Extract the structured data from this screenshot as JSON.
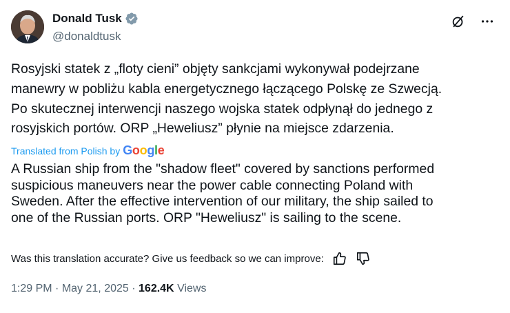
{
  "author": {
    "display_name": "Donald Tusk",
    "handle": "@donaldtusk",
    "verified_color": "#829aab"
  },
  "post": {
    "original_text": "Rosyjski statek z „floty cieni” objęty sankcjami wykonywał podejrzane\nmanewry w pobliżu kabla energetycznego łączącego Polskę ze Szwecją.\nPo skutecznej interwencji naszego wojska statek odpłynął do jednego z\nrosyjskich portów. ORP „Heweliusz” płynie na miejsce zdarzenia.",
    "translated_label": "Translated from Polish by",
    "translation_provider": "Google",
    "translated_text": "A Russian ship from the \"shadow fleet\" covered by sanctions performed\nsuspicious maneuvers near the power cable connecting Poland with\nSweden. After the effective intervention of our military, the ship sailed to\none of the Russian ports. ORP \"Heweliusz\" is sailing to the scene.",
    "feedback_prompt": "Was this translation accurate? Give us feedback so we can improve:"
  },
  "meta": {
    "time": "1:29 PM",
    "separator": "·",
    "date": "May 21, 2025",
    "views_count": "162.4K",
    "views_label": "Views"
  },
  "icons": {
    "verified": "verified-badge-icon",
    "grok": "grok-icon",
    "more": "more-options-icon",
    "thumbs_up": "thumbs-up-icon",
    "thumbs_down": "thumbs-down-icon"
  },
  "colors": {
    "link_blue": "#1d9bf0",
    "secondary_text": "#536471",
    "primary_text": "#0f1419",
    "google_blue": "#4285F4",
    "google_red": "#EA4335",
    "google_yellow": "#FBBC05",
    "google_green": "#34A853"
  }
}
